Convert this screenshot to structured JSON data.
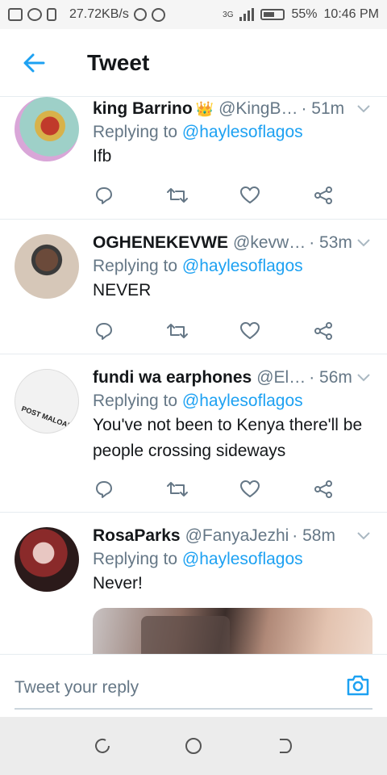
{
  "status_bar": {
    "speed": "27.72KB/s",
    "network": "3G",
    "battery": "55%",
    "time": "10:46 PM"
  },
  "header": {
    "title": "Tweet"
  },
  "tweets": [
    {
      "name": "king Barrino",
      "badge": "👑",
      "handle": "@KingB…",
      "time": "· 51m",
      "replying_label": "Replying to",
      "replying_to": "@haylesoflagos",
      "text": "Ifb"
    },
    {
      "name": "OGHENEKEVWE",
      "handle": "@kevw…",
      "time": "· 53m",
      "replying_label": "Replying to",
      "replying_to": "@haylesoflagos",
      "text": "NEVER"
    },
    {
      "name": "fundi wa earphones",
      "handle": "@El…",
      "time": "· 56m",
      "replying_label": "Replying to",
      "replying_to": "@haylesoflagos",
      "text": "You've not been to Kenya there'll be people crossing sideways",
      "avatar_text": "POST MALOAN"
    },
    {
      "name": "RosaParks",
      "handle": "@FanyaJezhi",
      "time": "· 58m",
      "replying_label": "Replying to",
      "replying_to": "@haylesoflagos",
      "text": "Never!"
    }
  ],
  "reply_bar": {
    "placeholder": "Tweet your reply"
  },
  "colors": {
    "accent": "#1da1f2",
    "muted": "#657786",
    "text": "#14171a",
    "divider": "#e6ecf0"
  },
  "icons": {
    "back": "arrow-left-icon",
    "reply": "reply-bubble-icon",
    "retweet": "retweet-icon",
    "like": "heart-icon",
    "share": "share-icon",
    "caret": "chevron-down-icon",
    "camera": "camera-icon"
  }
}
